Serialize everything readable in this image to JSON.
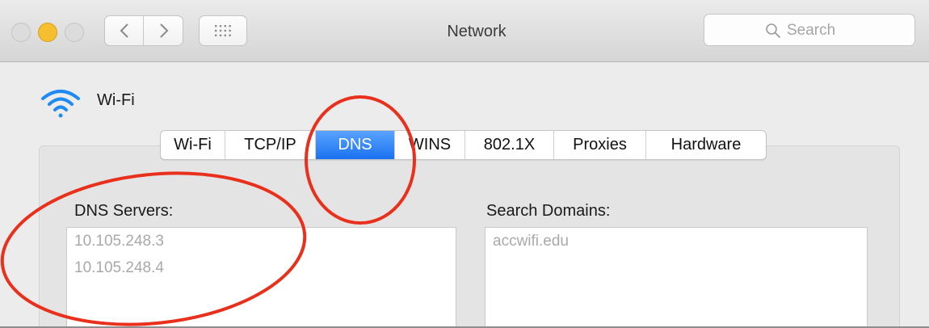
{
  "window": {
    "title": "Network",
    "search_placeholder": "Search"
  },
  "interface": {
    "name": "Wi-Fi",
    "icon": "wifi-icon"
  },
  "tabs": [
    {
      "label": "Wi-Fi",
      "active": false
    },
    {
      "label": "TCP/IP",
      "active": false
    },
    {
      "label": "DNS",
      "active": true
    },
    {
      "label": "WINS",
      "active": false
    },
    {
      "label": "802.1X",
      "active": false
    },
    {
      "label": "Proxies",
      "active": false
    },
    {
      "label": "Hardware",
      "active": false
    }
  ],
  "dns": {
    "servers_label": "DNS Servers:",
    "servers": [
      "10.105.248.3",
      "10.105.248.4"
    ],
    "search_domains_label": "Search Domains:",
    "search_domains": [
      "accwifi.edu"
    ]
  },
  "colors": {
    "accent": "#1a72f0",
    "annotation": "#e8301c",
    "traffic_yellow": "#f5bf2f"
  }
}
